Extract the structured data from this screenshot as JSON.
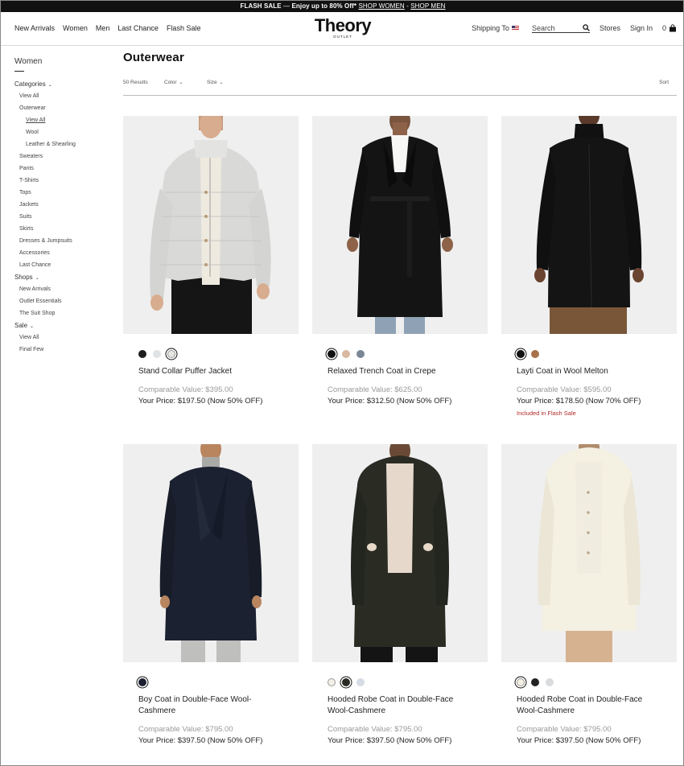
{
  "promo": {
    "lead": "FLASH SALE",
    "dash": " — ",
    "message": "Enjoy up to 80% Off*",
    "link_women": "SHOP WOMEN",
    "sep": " - ",
    "link_men": "SHOP MEN"
  },
  "header": {
    "nav": [
      "New Arrivals",
      "Women",
      "Men",
      "Last Chance",
      "Flash Sale"
    ],
    "logo_word": "Theory",
    "logo_sub": "OUTLET",
    "shipping_label": "Shipping To",
    "search_placeholder": "Search",
    "stores": "Stores",
    "sign_in": "Sign In",
    "bag_count": "0"
  },
  "sidebar": {
    "title": "Women",
    "categories_label": "Categories",
    "items": [
      {
        "label": "View All",
        "level": 1
      },
      {
        "label": "Outerwear",
        "level": 1
      },
      {
        "label": "View All",
        "level": 2,
        "active": true
      },
      {
        "label": "Wool",
        "level": 2
      },
      {
        "label": "Leather & Shearling",
        "level": 2
      },
      {
        "label": "Sweaters",
        "level": 1
      },
      {
        "label": "Pants",
        "level": 1
      },
      {
        "label": "T-Shirts",
        "level": 1
      },
      {
        "label": "Tops",
        "level": 1
      },
      {
        "label": "Jackets",
        "level": 1
      },
      {
        "label": "Suits",
        "level": 1
      },
      {
        "label": "Skirts",
        "level": 1
      },
      {
        "label": "Dresses & Jumpsuits",
        "level": 1
      },
      {
        "label": "Accessories",
        "level": 1
      },
      {
        "label": "Last Chance",
        "level": 1
      }
    ],
    "shops_label": "Shops",
    "shops": [
      "New Arrivals",
      "Outlet Essentials",
      "The Suit Shop"
    ],
    "sale_label": "Sale",
    "sale": [
      "View All",
      "Final Few"
    ]
  },
  "main": {
    "title": "Outerwear",
    "results": "50 Results",
    "color_filter": "Color",
    "size_filter": "Size",
    "sort": "Sort"
  },
  "products": [
    {
      "name": "Stand Collar Puffer Jacket",
      "comparable": "Comparable Value: $395.00",
      "price": "Your Price: $197.50 (Now 50% OFF)",
      "swatches": [
        "#1e1e1e",
        "#dfe3e6",
        "#e6e6e3"
      ],
      "selected": 2,
      "flash": ""
    },
    {
      "name": "Relaxed Trench Coat in Crepe",
      "comparable": "Comparable Value: $625.00",
      "price": "Your Price: $312.50 (Now 50% OFF)",
      "swatches": [
        "#111111",
        "#d8b9a2",
        "#7a8794"
      ],
      "selected": 0,
      "flash": ""
    },
    {
      "name": "Layti Coat in Wool Melton",
      "comparable": "Comparable Value: $595.00",
      "price": "Your Price: $178.50 (Now 70% OFF)",
      "swatches": [
        "#111111",
        "#a87249"
      ],
      "selected": 0,
      "flash": "Included in Flash Sale"
    },
    {
      "name": "Boy Coat in Double-Face Wool-Cashmere",
      "comparable": "Comparable Value: $795.00",
      "price": "Your Price: $397.50 (Now 50% OFF)",
      "swatches": [
        "#1b2130"
      ],
      "selected": 0,
      "flash": ""
    },
    {
      "name": "Hooded Robe Coat in Double-Face Wool-Cashmere",
      "comparable": "Comparable Value: $795.00",
      "price": "Your Price: $397.50 (Now 50% OFF)",
      "swatches": [
        "#f1efe6",
        "#2a2c24",
        "#d6dce4"
      ],
      "selected": 1,
      "flash": ""
    },
    {
      "name": "Hooded Robe Coat in Double-Face Wool-Cashmere",
      "comparable": "Comparable Value: $795.00",
      "price": "Your Price: $397.50 (Now 50% OFF)",
      "swatches": [
        "#f4f0e2",
        "#222222",
        "#d9dbdc"
      ],
      "selected": 0,
      "flash": ""
    }
  ],
  "colors": {
    "promo_bg": "#111111",
    "flash_red": "#b22a2a",
    "image_bg": "#efefef",
    "muted": "#999999"
  }
}
